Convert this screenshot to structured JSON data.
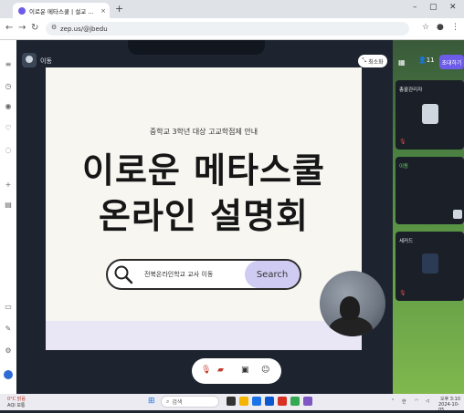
{
  "browser": {
    "tab_title": "이로운 메타스쿨 | 설교 재미있는",
    "url": "zep.us/@jbedu",
    "new_tab": "+",
    "tab_close": "×"
  },
  "app": {
    "room_label": "이동",
    "minimize_label": "최소화",
    "participant_count": "11",
    "invite_label": "초대하기"
  },
  "slide": {
    "subtitle": "중학교 3학년 대상 고교학점제 안내",
    "title_line1": "이로운 메타스쿨",
    "title_line2": "온라인 설명회",
    "search_text": "전북온라인학교 교사 이동",
    "search_button": "Search"
  },
  "participants": [
    {
      "name": "총괄관리자"
    },
    {
      "name": "이동"
    },
    {
      "name": "세커드"
    }
  ],
  "taskbar": {
    "search_label": "검색",
    "weather_line1": "0°C 맑음",
    "weather_line2": "AQI 보통",
    "time": "오후 3:10",
    "date": "2024-10-05"
  },
  "colors": {
    "accent": "#6c5ce7",
    "search_button_bg": "#cfcbf2",
    "mic_muted": "#e74c3c"
  }
}
